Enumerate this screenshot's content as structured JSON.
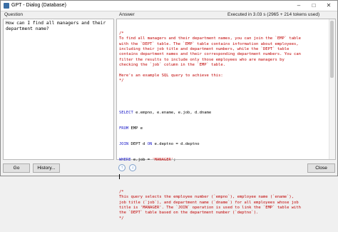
{
  "window": {
    "title": "GPT - Dialog (Database)",
    "min_icon": "minimize-icon",
    "max_icon": "maximize-icon",
    "close_icon": "close-icon"
  },
  "question": {
    "header": "Question",
    "text": "How can I find all managers and their department name?"
  },
  "answer": {
    "header": "Answer",
    "stats": "Executed in 3.03 s (2965 + 214 tokens used)",
    "comment1": [
      "/*",
      "To find all managers and their department names, you can join the `EMP` table",
      "with the `DEPT` table. The `EMP` table contains information about employees,",
      "including their job title and department numbers, while the `DEPT` table",
      "contains department names and their corresponding department numbers. You can",
      "filter the results to include only those employees who are managers by",
      "checking the `job` column in the `EMP` table.",
      "",
      "Here's an example SQL query to achieve this:",
      "*/"
    ],
    "sql": {
      "select_kw": "SELECT",
      "select_cols": " e.empno, e.ename, e.job, d.dname",
      "from_kw": "FROM",
      "from_rest": " EMP e",
      "join_kw": "JOIN",
      "join_rest": " DEPT d ",
      "on_kw": "ON",
      "on_rest": " e.deptno = d.deptno",
      "where_kw": "WHERE",
      "where_rest": " e.job = ",
      "where_value": "'MANAGER'",
      "where_end": ";"
    },
    "comment2": [
      "/*",
      "This query selects the employee number (`empno`), employee name (`ename`),",
      "job title (`job`), and department name (`dname`) for all employees whose job",
      "title is 'MANAGER'. The `JOIN` operation is used to link the `EMP` table with",
      "the `DEPT` table based on the department number (`deptno`).",
      "*/"
    ]
  },
  "buttons": {
    "go": "Go",
    "history": "History...",
    "close": "Close"
  },
  "nav": {
    "up_icon": "arrow-up-icon",
    "down_icon": "arrow-down-icon",
    "up_glyph": "↑",
    "down_glyph": "↓"
  }
}
